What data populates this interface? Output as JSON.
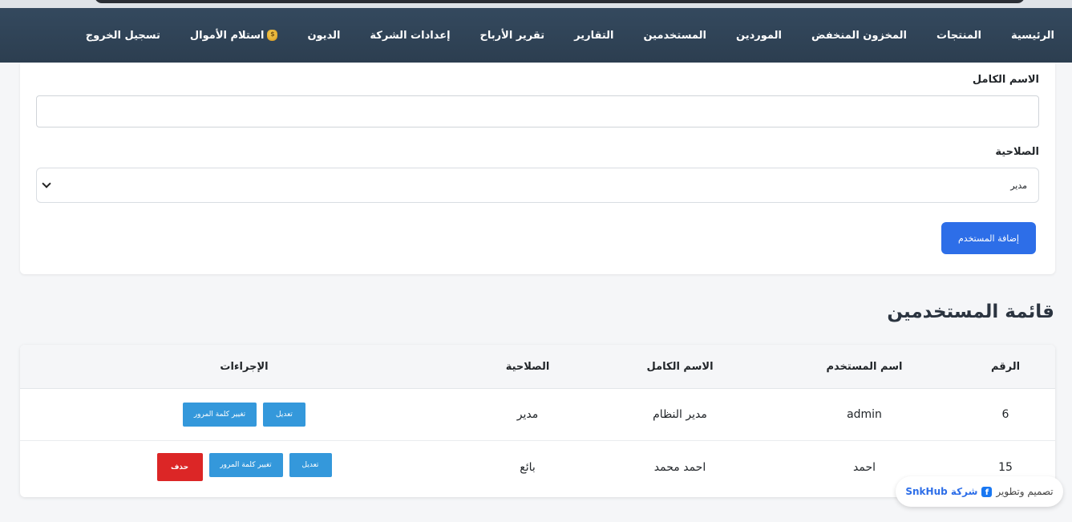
{
  "nav": {
    "items": [
      {
        "label": "الرئيسية",
        "name": "nav-home"
      },
      {
        "label": "المنتجات",
        "name": "nav-products"
      },
      {
        "label": "المخزون المنخفض",
        "name": "nav-low-stock"
      },
      {
        "label": "الموردين",
        "name": "nav-suppliers"
      },
      {
        "label": "المستخدمين",
        "name": "nav-users"
      },
      {
        "label": "التقارير",
        "name": "nav-reports"
      },
      {
        "label": "تقرير الأرباح",
        "name": "nav-profit-report"
      },
      {
        "label": "إعدادات الشركة",
        "name": "nav-company-settings"
      },
      {
        "label": "الديون",
        "name": "nav-debts"
      },
      {
        "label": "استلام الأموال",
        "name": "nav-receive-money",
        "icon": "money-bag-icon"
      },
      {
        "label": "تسجيل الخروج",
        "name": "nav-logout"
      }
    ]
  },
  "form": {
    "fullname_label": "الاسم الكامل",
    "fullname_value": "",
    "role_label": "الصلاحية",
    "role_selected": "مدير",
    "submit_label": "إضافة المستخدم"
  },
  "users_section": {
    "title": "قائمة المستخدمين",
    "headers": {
      "num": "الرقم",
      "username": "اسم المستخدم",
      "fullname": "الاسم الكامل",
      "role": "الصلاحية",
      "actions": "الإجراءات"
    },
    "rows": [
      {
        "num": "6",
        "username": "admin",
        "fullname": "مدير النظام",
        "role": "مدير",
        "edit": "تعديل",
        "change_password": "تغيير كلمة المرور"
      },
      {
        "num": "15",
        "username": "احمد",
        "fullname": "احمد محمد",
        "role": "بائع",
        "edit": "تعديل",
        "change_password": "تغيير كلمة المرور",
        "delete": "حذف"
      }
    ]
  },
  "credit": {
    "text": "تصميم وتطوير",
    "company": "شركة SnkHub",
    "icon": "facebook-icon"
  },
  "colors": {
    "navbar": "#2c3e50",
    "primary": "#2d6ee8",
    "action_blue": "#3498db",
    "danger": "#dc2626"
  }
}
